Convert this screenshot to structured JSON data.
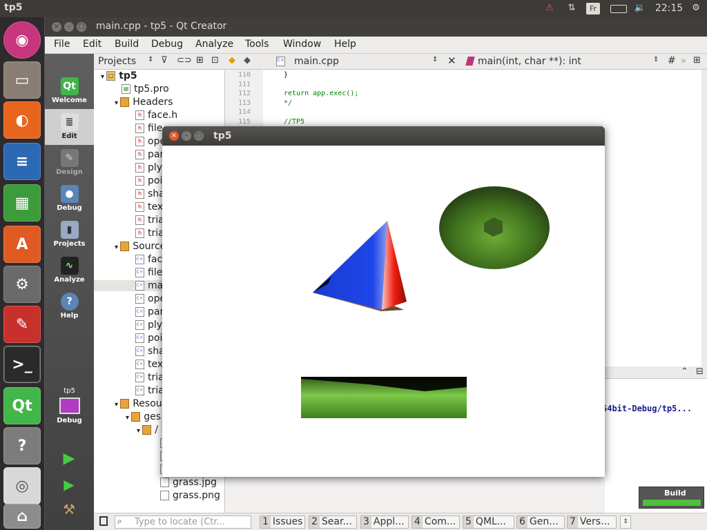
{
  "topbar": {
    "app": "tp5",
    "lang": "Fr",
    "time": "22:15"
  },
  "qtcreator": {
    "title": "main.cpp - tp5 - Qt Creator"
  },
  "menu": [
    "File",
    "Edit",
    "Build",
    "Debug",
    "Analyze",
    "Tools",
    "Window",
    "Help"
  ],
  "modes": [
    "Welcome",
    "Edit",
    "Design",
    "Debug",
    "Projects",
    "Analyze",
    "Help"
  ],
  "kit": {
    "project": "tp5",
    "mode": "Debug"
  },
  "projects": {
    "header": "Projects",
    "tree": [
      {
        "label": "tp5",
        "type": "project"
      },
      {
        "label": "tp5.pro",
        "type": "pro"
      },
      {
        "label": "Headers",
        "type": "folder"
      },
      {
        "label": "face.h",
        "type": "h"
      },
      {
        "label": "file",
        "type": "h"
      },
      {
        "label": "ope",
        "type": "h"
      },
      {
        "label": "par",
        "type": "h"
      },
      {
        "label": "ply",
        "type": "h"
      },
      {
        "label": "poi",
        "type": "h"
      },
      {
        "label": "sha",
        "type": "h"
      },
      {
        "label": "tex",
        "type": "h"
      },
      {
        "label": "tria",
        "type": "h"
      },
      {
        "label": "tria",
        "type": "h"
      },
      {
        "label": "Source",
        "type": "folder"
      },
      {
        "label": "fac",
        "type": "cpp"
      },
      {
        "label": "file",
        "type": "cpp"
      },
      {
        "label": "ma",
        "type": "cpp"
      },
      {
        "label": "ope",
        "type": "cpp"
      },
      {
        "label": "par",
        "type": "cpp"
      },
      {
        "label": "ply",
        "type": "cpp"
      },
      {
        "label": "poi",
        "type": "cpp"
      },
      {
        "label": "sha",
        "type": "cpp"
      },
      {
        "label": "tex",
        "type": "cpp"
      },
      {
        "label": "tria",
        "type": "cpp"
      },
      {
        "label": "tria",
        "type": "cpp"
      },
      {
        "label": "Resou",
        "type": "folder"
      },
      {
        "label": "ges",
        "type": "folder"
      },
      {
        "label": "/",
        "type": "folder"
      },
      {
        "label": "",
        "type": "file"
      },
      {
        "label": "",
        "type": "file"
      },
      {
        "label": "",
        "type": "file"
      },
      {
        "label": "grass.jpg",
        "type": "file"
      },
      {
        "label": "grass.png",
        "type": "file"
      }
    ]
  },
  "editor": {
    "file": "main.cpp",
    "symbol": "main(int, char **): int",
    "hash": "#",
    "lines": [
      {
        "n": "110",
        "text": "}"
      },
      {
        "n": "111",
        "text": ""
      },
      {
        "n": "112",
        "text": "return app.exec();"
      },
      {
        "n": "113",
        "text": "*/"
      },
      {
        "n": "114",
        "text": ""
      },
      {
        "n": "115",
        "text": "//TP5"
      }
    ]
  },
  "output": {
    "path": "54bit-Debug/tp5..."
  },
  "build": {
    "label": "Build"
  },
  "locator": {
    "placeholder": "Type to locate (Ctr..."
  },
  "panes": [
    {
      "n": "1",
      "label": "Issues"
    },
    {
      "n": "2",
      "label": "Sear..."
    },
    {
      "n": "3",
      "label": "Appl..."
    },
    {
      "n": "4",
      "label": "Com..."
    },
    {
      "n": "5",
      "label": "QML..."
    },
    {
      "n": "6",
      "label": "Gen..."
    },
    {
      "n": "7",
      "label": "Vers..."
    }
  ],
  "tp5window": {
    "title": "tp5"
  },
  "colors": {
    "pyramid_blue": "#1d3fd0",
    "pyramid_red": "#e01c10",
    "grass": "#3f8a1e"
  }
}
